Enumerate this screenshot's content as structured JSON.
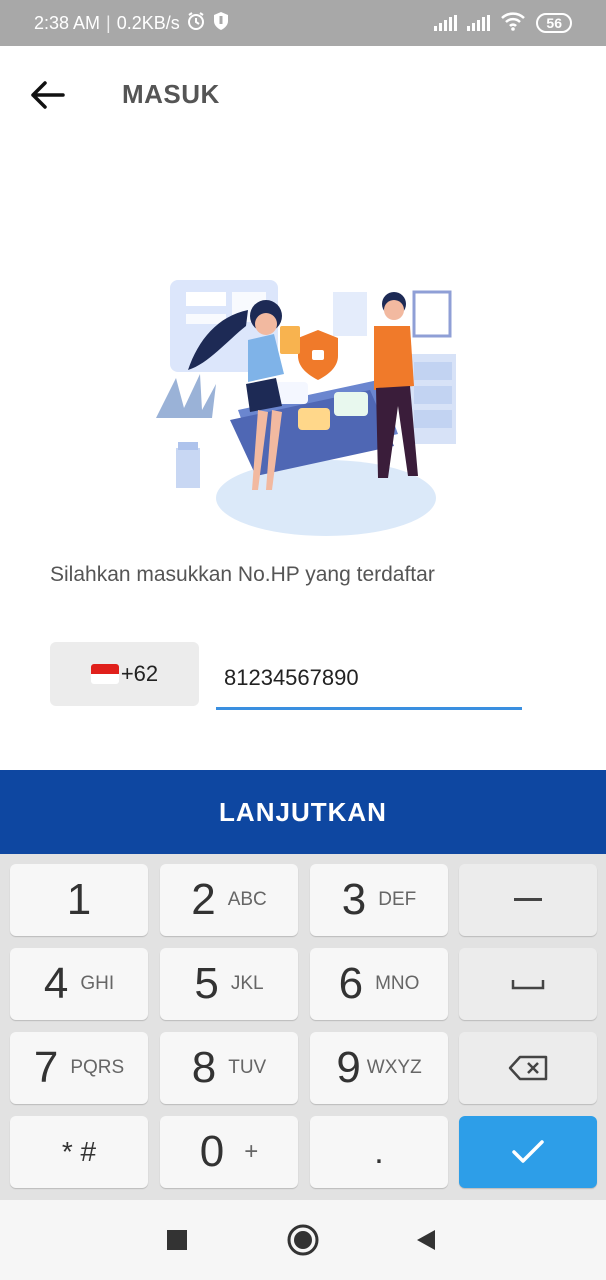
{
  "status_bar": {
    "time": "2:38 AM",
    "net_speed": "0.2KB/s",
    "battery": "56",
    "icons": [
      "alarm-icon",
      "shield-icon",
      "signal-icon",
      "signal-icon",
      "wifi-icon",
      "battery-icon"
    ]
  },
  "header": {
    "back_icon": "arrow-left-icon",
    "title": "MASUK"
  },
  "main": {
    "illustration": "security-illustration",
    "instruction": "Silahkan masukkan No.HP yang terdaftar",
    "country_code": "+62",
    "flag_icon": "indonesia-flag-icon",
    "phone_value": "81234567890",
    "submit_label": "LANJUTKAN"
  },
  "keypad": {
    "keys": [
      {
        "digit": "1",
        "letters": ""
      },
      {
        "digit": "2",
        "letters": "ABC"
      },
      {
        "digit": "3",
        "letters": "DEF"
      },
      {
        "digit": "4",
        "letters": "GHI"
      },
      {
        "digit": "5",
        "letters": "JKL"
      },
      {
        "digit": "6",
        "letters": "MNO"
      },
      {
        "digit": "7",
        "letters": "PQRS"
      },
      {
        "digit": "8",
        "letters": "TUV"
      },
      {
        "digit": "9",
        "letters": "WXYZ"
      },
      {
        "digit": "* #",
        "letters": ""
      },
      {
        "digit": "0",
        "letters": "+"
      },
      {
        "digit": ".",
        "letters": ""
      }
    ],
    "function_icons": [
      "minus-icon",
      "space-icon",
      "backspace-icon",
      "check-icon"
    ]
  },
  "nav_bar": {
    "icons": [
      "recents-square-icon",
      "home-circle-icon",
      "back-triangle-icon"
    ]
  },
  "colors": {
    "accent": "#0e47a1",
    "input_underline": "#3a8fe0",
    "done_key": "#2d9ee8",
    "status_bar": "#a8a8a8"
  }
}
